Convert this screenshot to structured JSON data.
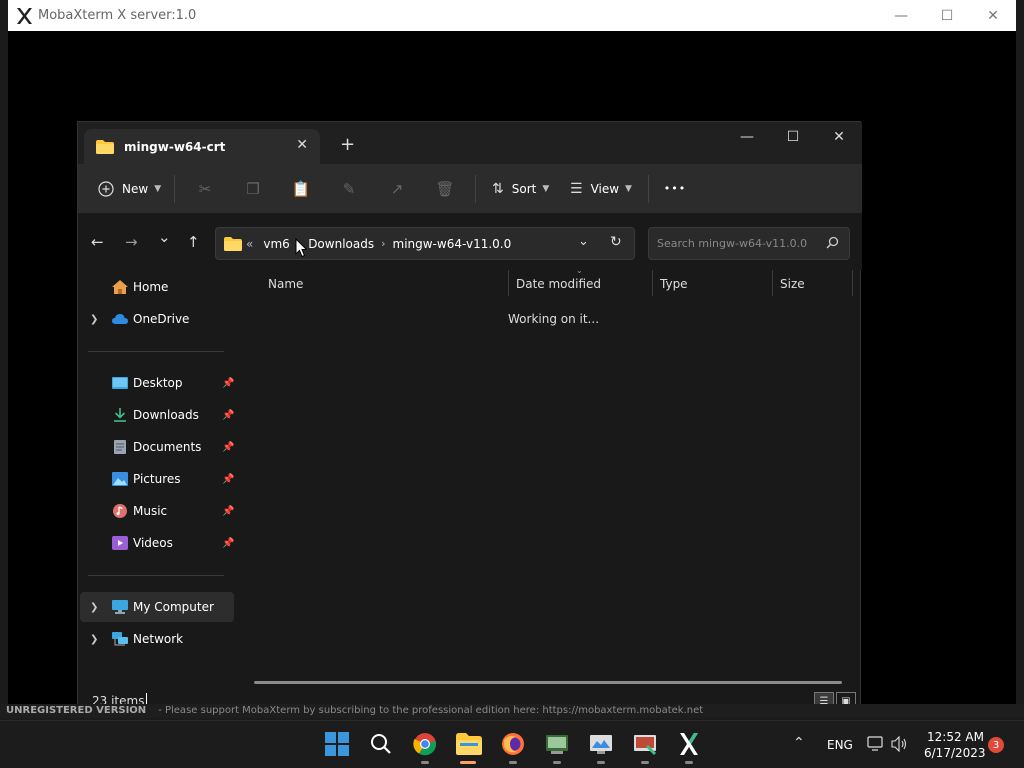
{
  "xserver": {
    "title": "MobaXterm X server:1.0",
    "minimize": "—",
    "maximize": "☐",
    "close": "✕"
  },
  "banner": {
    "label": "UNREGISTERED VERSION",
    "text": "- Please support MobaXterm by subscribing to the professional edition here: https://mobaxterm.mobatek.net"
  },
  "explorer": {
    "tab_title": "mingw-w64-crt",
    "tab_close": "✕",
    "new_tab": "+",
    "win_min": "—",
    "win_max": "☐",
    "win_close": "✕",
    "commands": {
      "new": "New",
      "sort": "Sort",
      "view": "View",
      "more": "•••"
    },
    "nav": {
      "back": "←",
      "forward": "→",
      "recent": "⌄",
      "up": "↑",
      "overflow": "«",
      "refresh": "↻",
      "dropdown": "⌄"
    },
    "breadcrumb": [
      "vm6",
      "Downloads",
      "mingw-w64-v11.0.0"
    ],
    "search_placeholder": "Search mingw-w64-v11.0.0",
    "sidebar": {
      "home": "Home",
      "onedrive": "OneDrive",
      "desktop": "Desktop",
      "downloads": "Downloads",
      "documents": "Documents",
      "pictures": "Pictures",
      "music": "Music",
      "videos": "Videos",
      "mycomputer": "My Computer",
      "network": "Network"
    },
    "columns": {
      "name": "Name",
      "date": "Date modified",
      "type": "Type",
      "size": "Size"
    },
    "working": "Working on it...",
    "status_count": "23 items"
  },
  "taskbar": {
    "lang": "ENG",
    "time": "12:52 AM",
    "date": "6/17/2023",
    "notifications": "3"
  },
  "colors": {
    "accent": "#ffc83d",
    "start": "#3a96dd"
  }
}
